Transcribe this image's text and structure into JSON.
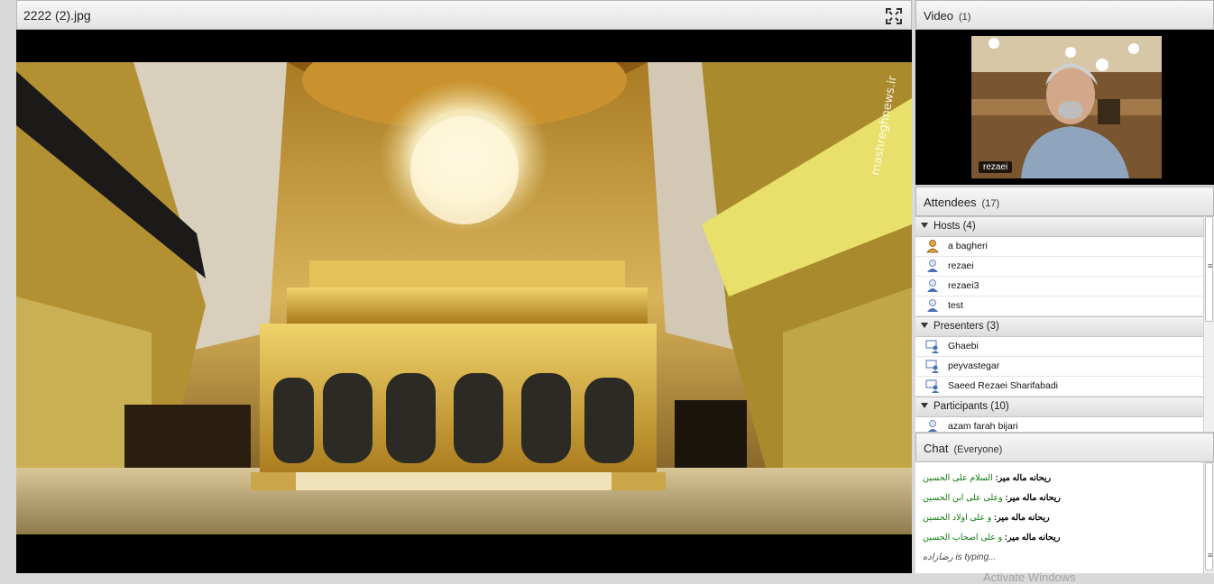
{
  "share_pod": {
    "title": "2222 (2).jpg",
    "watermark": "mashreghnews.ir"
  },
  "video_pod": {
    "title": "Video",
    "count": "(1)",
    "speaker_name": "rezaei"
  },
  "attendees_pod": {
    "title": "Attendees",
    "count": "(17)",
    "groups": {
      "hosts": {
        "label": "Hosts (4)",
        "members": [
          "a bagheri",
          "rezaei",
          "rezaei3",
          "test"
        ]
      },
      "presenters": {
        "label": "Presenters (3)",
        "members": [
          " Ghaebi",
          "peyvastegar",
          "Saeed Rezaei Sharifabadi"
        ]
      },
      "participants": {
        "label": "Participants (10)",
        "members": [
          "azam farah bijari"
        ]
      }
    }
  },
  "chat_pod": {
    "title": "Chat",
    "scope": "(Everyone)",
    "messages": [
      {
        "sender": "ریحانه ماله میر:",
        "text": "السلام علی الحسین"
      },
      {
        "sender": "ریحانه ماله میر:",
        "text": "وعلی علی ابن الحسین"
      },
      {
        "sender": "ریحانه ماله میر:",
        "text": "و علی اولاد الحسین"
      },
      {
        "sender": "ریحانه ماله میر:",
        "text": "و علی اصحاب الحسین"
      }
    ],
    "typing": "رضازاده is typing...",
    "overlay": "Activate Windows"
  },
  "colors": {
    "chat_text": "#0d7a0d",
    "host_icon": "#e8a33a",
    "presenter_icon": "#4a6fb3"
  }
}
